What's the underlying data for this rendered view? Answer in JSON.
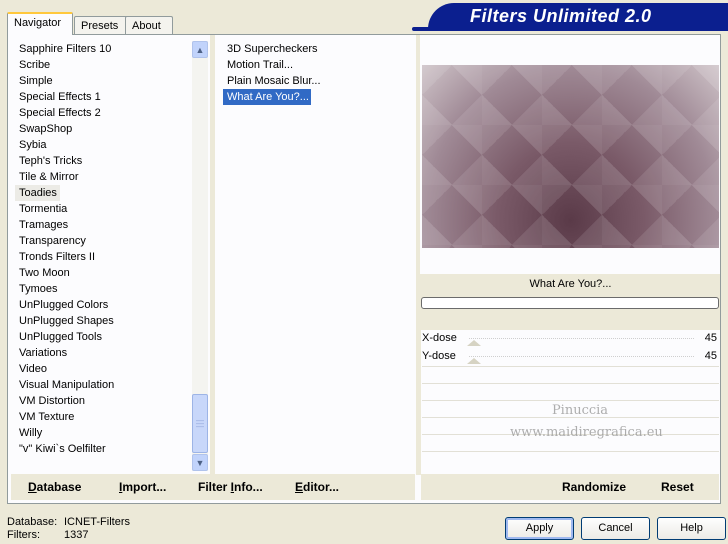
{
  "banner": {
    "title": "Filters Unlimited 2.0"
  },
  "tabs": [
    {
      "label": "Navigator"
    },
    {
      "label": "Presets"
    },
    {
      "label": "About"
    }
  ],
  "categories": {
    "items": [
      "Sapphire Filters 10",
      "Scribe",
      "Simple",
      "Special Effects 1",
      "Special Effects 2",
      "SwapShop",
      "Sybia",
      "Teph's Tricks",
      "Tile & Mirror",
      "Toadies",
      "Tormentia",
      "Tramages",
      "Transparency",
      "Tronds Filters II",
      "Two Moon",
      "Tymoes",
      "UnPlugged Colors",
      "UnPlugged Shapes",
      "UnPlugged Tools",
      "Variations",
      "Video",
      "Visual Manipulation",
      "VM Distortion",
      "VM Texture",
      "Willy",
      "\"v\" Kiwi`s Oelfilter"
    ],
    "highlighted": "Toadies"
  },
  "filters": {
    "items": [
      "3D Supercheckers",
      "Motion Trail...",
      "Plain Mosaic Blur...",
      "What Are You?..."
    ],
    "selected": "What Are You?..."
  },
  "preview": {
    "filter_name": "What Are You?..."
  },
  "sliders": [
    {
      "label": "X-dose",
      "value": "45"
    },
    {
      "label": "Y-dose",
      "value": "45"
    }
  ],
  "toolbar": {
    "database_label": "Database",
    "database_key": "D",
    "database_rest": "atabase",
    "import_key": "I",
    "import_rest": "mport...",
    "filter_info_before": "Filter ",
    "filter_info_key": "I",
    "filter_info_rest": "nfo...",
    "editor_key": "E",
    "editor_rest": "ditor...",
    "randomize_label": "Randomize",
    "reset_label": "Reset"
  },
  "status": {
    "database_label": "Database:",
    "database_value": "ICNET-Filters",
    "filters_label": "Filters:",
    "filters_value": "1337"
  },
  "buttons": {
    "apply": "Apply",
    "cancel": "Cancel",
    "help": "Help"
  },
  "watermark": {
    "line1": "Pinuccia",
    "line2": "www.maidiregrafica.eu"
  },
  "colors": {
    "banner": "#0b1f8f",
    "selection": "#316ac5",
    "tab_accent": "#ffc83c"
  }
}
